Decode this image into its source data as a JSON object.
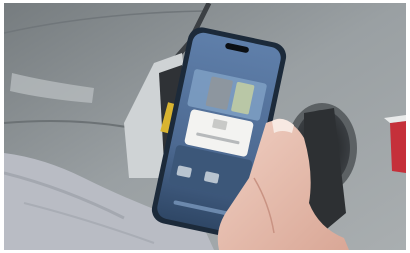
{
  "scene": {
    "description_tag": "photo",
    "colors": {
      "background_car": "#8d9294",
      "phone_frame": "#1c2a3a",
      "phone_screen": "#5f7faa",
      "skin": "#e9c2b4",
      "sleeve": "#b9bcc4",
      "charging_port": "#2a2d30",
      "tail_light": "#c5303a"
    }
  },
  "phone_screen": {
    "status_time": "",
    "title": "",
    "dialog_text": ""
  }
}
